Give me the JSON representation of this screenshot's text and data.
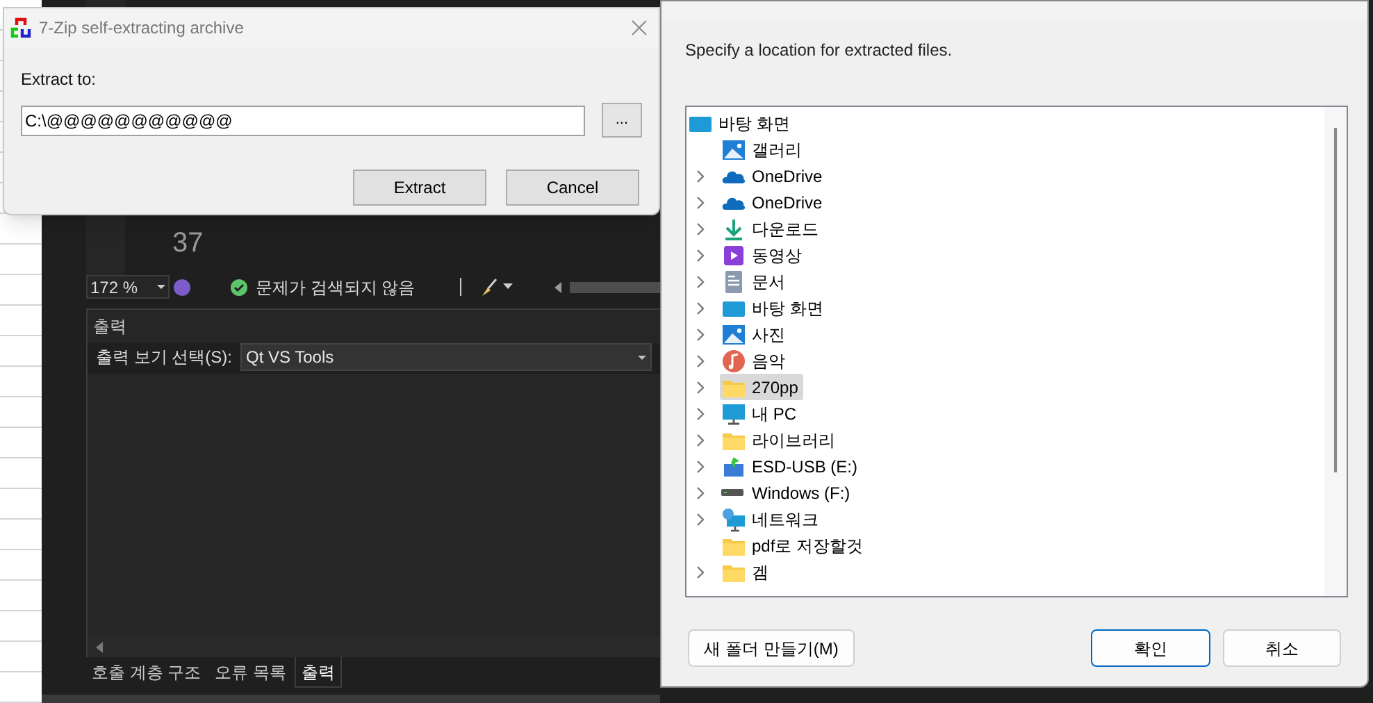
{
  "editor": {
    "line_numbers": [
      "37"
    ],
    "status_bar": {
      "zoom": "172 %",
      "issues": "문제가 검색되지 않음"
    }
  },
  "output_panel": {
    "title": "출력",
    "source_label": "출력 보기 선택(S):",
    "source_value": "Qt VS Tools"
  },
  "bottom_tabs": [
    {
      "label": "호출 계층 구조",
      "selected": false
    },
    {
      "label": "오류 목록",
      "selected": false
    },
    {
      "label": "출력",
      "selected": true
    }
  ],
  "zip_dialog": {
    "title": "7-Zip self-extracting archive",
    "extract_label": "Extract to:",
    "path_value": "C:\\@@@@@@@@@@@",
    "browse_button": "...",
    "buttons": [
      "Extract",
      "Cancel"
    ]
  },
  "folder_dialog": {
    "instruction": "Specify a location for extracted files.",
    "tree": {
      "label": "바탕 화면",
      "kind": "desktop",
      "children": [
        {
          "label": "갤러리",
          "kind": "gallery",
          "expandable": false,
          "selected": false
        },
        {
          "label": "OneDrive",
          "kind": "cloud",
          "expandable": true,
          "selected": false
        },
        {
          "label": "OneDrive",
          "kind": "cloud",
          "expandable": true,
          "selected": false
        },
        {
          "label": "다운로드",
          "kind": "download",
          "expandable": true,
          "selected": false
        },
        {
          "label": "동영상",
          "kind": "video",
          "expandable": true,
          "selected": false
        },
        {
          "label": "문서",
          "kind": "document",
          "expandable": true,
          "selected": false
        },
        {
          "label": "바탕 화면",
          "kind": "desktop",
          "expandable": true,
          "selected": false
        },
        {
          "label": "사진",
          "kind": "gallery",
          "expandable": true,
          "selected": false
        },
        {
          "label": "음악",
          "kind": "music",
          "expandable": true,
          "selected": false
        },
        {
          "label": "270pp",
          "kind": "folder",
          "expandable": true,
          "selected": true
        },
        {
          "label": "내 PC",
          "kind": "monitor",
          "expandable": true,
          "selected": false
        },
        {
          "label": "라이브러리",
          "kind": "folder",
          "expandable": true,
          "selected": false
        },
        {
          "label": "ESD-USB (E:)",
          "kind": "usb",
          "expandable": true,
          "selected": false
        },
        {
          "label": "Windows (F:)",
          "kind": "drive",
          "expandable": true,
          "selected": false
        },
        {
          "label": "네트워크",
          "kind": "network",
          "expandable": true,
          "selected": false
        },
        {
          "label": "pdf로 저장할것",
          "kind": "folder",
          "expandable": false,
          "selected": false
        },
        {
          "label": "겜",
          "kind": "folder",
          "expandable": true,
          "selected": false
        }
      ]
    },
    "new_folder_button": "새 폴더 만들기(M)",
    "buttons": [
      {
        "label": "확인",
        "default": true
      },
      {
        "label": "취소",
        "default": false
      }
    ]
  }
}
